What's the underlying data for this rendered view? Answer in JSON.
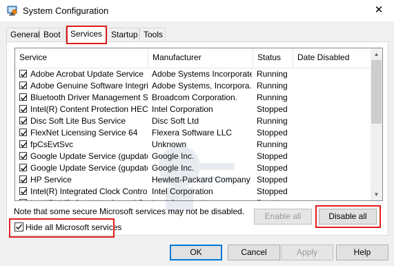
{
  "window": {
    "title": "System Configuration",
    "close_glyph": "✕"
  },
  "tabs": [
    {
      "label": "General",
      "active": false
    },
    {
      "label": "Boot",
      "active": false
    },
    {
      "label": "Services",
      "active": true
    },
    {
      "label": "Startup",
      "active": false
    },
    {
      "label": "Tools",
      "active": false
    }
  ],
  "columns": {
    "service": "Service",
    "manufacturer": "Manufacturer",
    "status": "Status",
    "date_disabled": "Date Disabled"
  },
  "services": [
    {
      "service": "Adobe Acrobat Update Service",
      "manufacturer": "Adobe Systems Incorporated",
      "status": "Running",
      "date_disabled": "",
      "checked": true
    },
    {
      "service": "Adobe Genuine Software Integri...",
      "manufacturer": "Adobe Systems, Incorpora...",
      "status": "Running",
      "date_disabled": "",
      "checked": true
    },
    {
      "service": "Bluetooth Driver Management S...",
      "manufacturer": "Broadcom Corporation.",
      "status": "Running",
      "date_disabled": "",
      "checked": true
    },
    {
      "service": "Intel(R) Content Protection HEC...",
      "manufacturer": "Intel Corporation",
      "status": "Stopped",
      "date_disabled": "",
      "checked": true
    },
    {
      "service": "Disc Soft Lite Bus Service",
      "manufacturer": "Disc Soft Ltd",
      "status": "Running",
      "date_disabled": "",
      "checked": true
    },
    {
      "service": "FlexNet Licensing Service 64",
      "manufacturer": "Flexera Software LLC",
      "status": "Stopped",
      "date_disabled": "",
      "checked": true
    },
    {
      "service": "fpCsEvtSvc",
      "manufacturer": "Unknown",
      "status": "Running",
      "date_disabled": "",
      "checked": true
    },
    {
      "service": "Google Update Service (gupdate)",
      "manufacturer": "Google Inc.",
      "status": "Stopped",
      "date_disabled": "",
      "checked": true
    },
    {
      "service": "Google Update Service (gupdatem)",
      "manufacturer": "Google Inc.",
      "status": "Stopped",
      "date_disabled": "",
      "checked": true
    },
    {
      "service": "HP Service",
      "manufacturer": "Hewlett-Packard Company",
      "status": "Stopped",
      "date_disabled": "",
      "checked": true
    },
    {
      "service": "Intel(R) Integrated Clock Contro...",
      "manufacturer": "Intel Corporation",
      "status": "Stopped",
      "date_disabled": "",
      "checked": true
    },
    {
      "service": "Intel(R) HD Graphics Control Pa...",
      "manufacturer": "Intel Corporation",
      "status": "Running",
      "date_disabled": "",
      "checked": true
    }
  ],
  "note": "Note that some secure Microsoft services may not be disabled.",
  "buttons": {
    "enable_all": "Enable all",
    "disable_all": "Disable all",
    "ok": "OK",
    "cancel": "Cancel",
    "apply": "Apply",
    "help": "Help"
  },
  "hide_microsoft": {
    "label": "Hide all Microsoft services",
    "checked": true
  },
  "colors": {
    "highlight": "#e01b1b",
    "default_button_border": "#0078d7"
  }
}
